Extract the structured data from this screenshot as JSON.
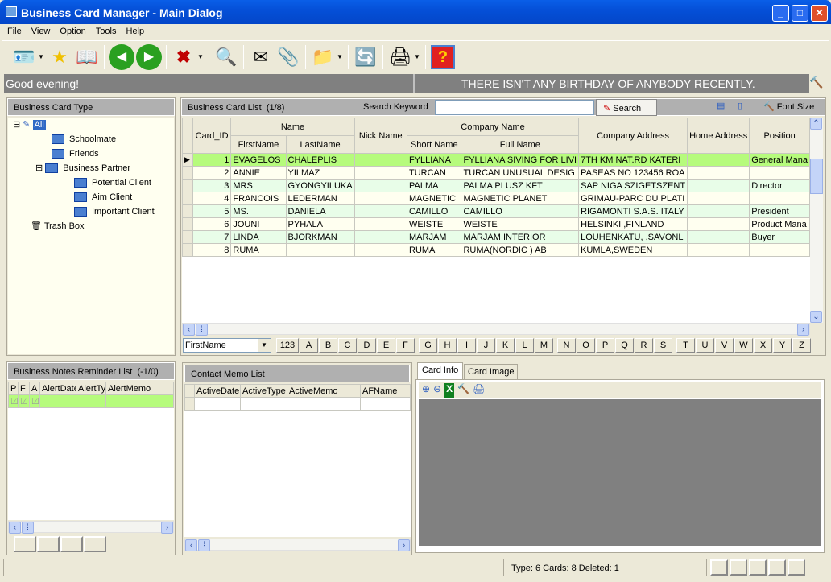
{
  "window": {
    "title": "Business Card Manager - Main Dialog",
    "minimize": "_",
    "maximize": "□",
    "close": "✕"
  },
  "menu": [
    "File",
    "View",
    "Option",
    "Tools",
    "Help"
  ],
  "toolbar": {
    "icons": [
      "new-card-icon",
      "favorite-icon",
      "open-book-icon",
      "back-icon",
      "forward-icon",
      "delete-icon",
      "search-icon",
      "email-icon",
      "attach-icon",
      "folder-import-icon",
      "sync-icon",
      "print-icon",
      "help-icon"
    ]
  },
  "greeting": {
    "left": "Good evening!",
    "right": "THERE ISN'T ANY BIRTHDAY OF ANYBODY RECENTLY."
  },
  "tree": {
    "title": "Business Card Type",
    "items": [
      {
        "label": "All",
        "level": 0,
        "selected": true
      },
      {
        "label": "Schoolmate",
        "level": 1
      },
      {
        "label": "Friends",
        "level": 1
      },
      {
        "label": "Business Partner",
        "level": 1
      },
      {
        "label": "Potential Client",
        "level": 2
      },
      {
        "label": "Aim Client",
        "level": 2
      },
      {
        "label": "Important Client",
        "level": 2
      },
      {
        "label": "Trash Box",
        "level": 0
      }
    ]
  },
  "cardlist": {
    "title": "Business Card List",
    "count": "(1/8)",
    "search_label": "Search Keyword",
    "search_value": "",
    "search_button": "Search",
    "font_size": "Font Size",
    "headers": {
      "card_id": "Card_ID",
      "name": "Name",
      "first": "FirstName",
      "last": "LastName",
      "nick": "Nick Name",
      "company": "Company Name",
      "short": "Short Name",
      "full": "Full Name",
      "address": "Company Address",
      "home": "Home Address",
      "position": "Position"
    },
    "rows": [
      [
        "1",
        "EVAGELOS",
        "CHALEPLIS",
        "",
        "FYLLIANA",
        "FYLLIANA SIVING FOR LIVI",
        "7TH KM NAT.RD KATERI",
        "",
        "General Mana"
      ],
      [
        "2",
        "ANNIE",
        "YILMAZ",
        "",
        "TURCAN",
        "TURCAN UNUSUAL DESIG",
        "PASEAS NO 123456  ROA",
        "",
        ""
      ],
      [
        "3",
        "MRS",
        "GYONGYILUKA",
        "",
        "PALMA",
        "PALMA PLUSZ KFT",
        "SAP NIGA SZIGETSZENT",
        "",
        "Director"
      ],
      [
        "4",
        "FRANCOIS",
        "LEDERMAN",
        "",
        "MAGNETIC",
        "MAGNETIC PLANET",
        "GRIMAU-PARC DU PLATI",
        "",
        ""
      ],
      [
        "5",
        "MS.",
        "DANIELA",
        "",
        "CAMILLO",
        "CAMILLO",
        "RIGAMONTI S.A.S. ITALY",
        "",
        "President"
      ],
      [
        "6",
        "JOUNI",
        "PYHALA",
        "",
        "WEISTE",
        "WEISTE",
        "HELSINKI ,FINLAND",
        "",
        "Product Mana"
      ],
      [
        "7",
        "LINDA",
        "BJORKMAN",
        "",
        "MARJAM",
        "MARJAM INTERIOR",
        "LOUHENKATU,  ,SAVONL",
        "",
        "Buyer"
      ],
      [
        "8",
        "RUMA",
        "",
        "",
        "RUMA",
        "RUMA(NORDIC ) AB",
        "KUMLA,SWEDEN",
        "",
        ""
      ]
    ],
    "selected_row": 0,
    "filter_field": "FirstName",
    "alpha": [
      "123",
      "A",
      "B",
      "C",
      "D",
      "E",
      "F",
      "G",
      "H",
      "I",
      "J",
      "K",
      "L",
      "M",
      "N",
      "O",
      "P",
      "Q",
      "R",
      "S",
      "T",
      "U",
      "V",
      "W",
      "X",
      "Y",
      "Z"
    ]
  },
  "notes": {
    "title": "Business Notes Reminder List",
    "count": "(-1/0)",
    "headers": [
      "P",
      "F",
      "A",
      "AlertDate",
      "AlertType",
      "AlertMemo"
    ]
  },
  "memo": {
    "title": "Contact Memo List",
    "headers": [
      "ActiveDate",
      "ActiveType",
      "ActiveMemo",
      "AFName"
    ]
  },
  "cardinfo": {
    "tabs": [
      "Card Info",
      "Card Image"
    ],
    "active_tab": 0
  },
  "status": {
    "text": "Type: 6 Cards: 8 Deleted: 1"
  },
  "colors": {
    "selected_row": "#b6fb7c",
    "odd_row": "#e8fde8",
    "even_row": "#fffff0",
    "title_bar": "#0550d8",
    "header_bar": "#808080"
  }
}
